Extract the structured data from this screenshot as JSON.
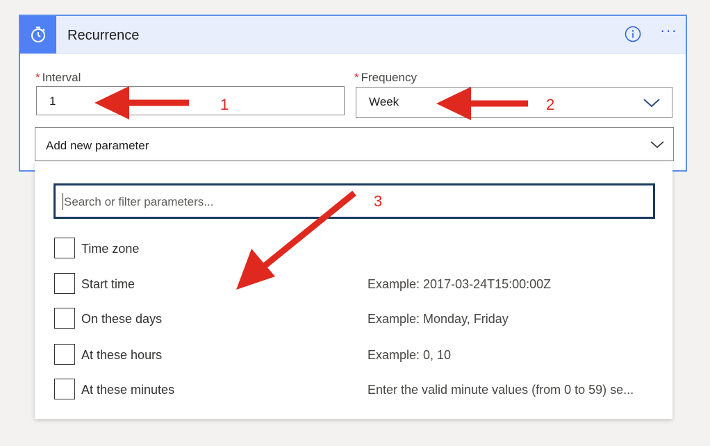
{
  "card": {
    "title": "Recurrence",
    "icon": "alarm-clock-icon",
    "info_icon": "info-icon",
    "more_icon": "more-options-icon",
    "more_label": "···"
  },
  "interval": {
    "label": "Interval",
    "required_mark": "*",
    "value": "1"
  },
  "frequency": {
    "label": "Frequency",
    "required_mark": "*",
    "value": "Week"
  },
  "add_parameter": {
    "label": "Add new parameter"
  },
  "search": {
    "placeholder": "Search or filter parameters..."
  },
  "parameters": [
    {
      "label": "Time zone",
      "hint": ""
    },
    {
      "label": "Start time",
      "hint": "Example: 2017-03-24T15:00:00Z"
    },
    {
      "label": "On these days",
      "hint": "Example: Monday, Friday"
    },
    {
      "label": "At these hours",
      "hint": "Example: 0, 10"
    },
    {
      "label": "At these minutes",
      "hint": "Enter the valid minute values (from 0 to 59) se..."
    }
  ],
  "annotations": {
    "one": "1",
    "two": "2",
    "three": "3"
  },
  "colors": {
    "accent": "#4f81f5",
    "header_bg": "#e8eefc",
    "required": "#d13438",
    "annotation": "#e0291e"
  }
}
